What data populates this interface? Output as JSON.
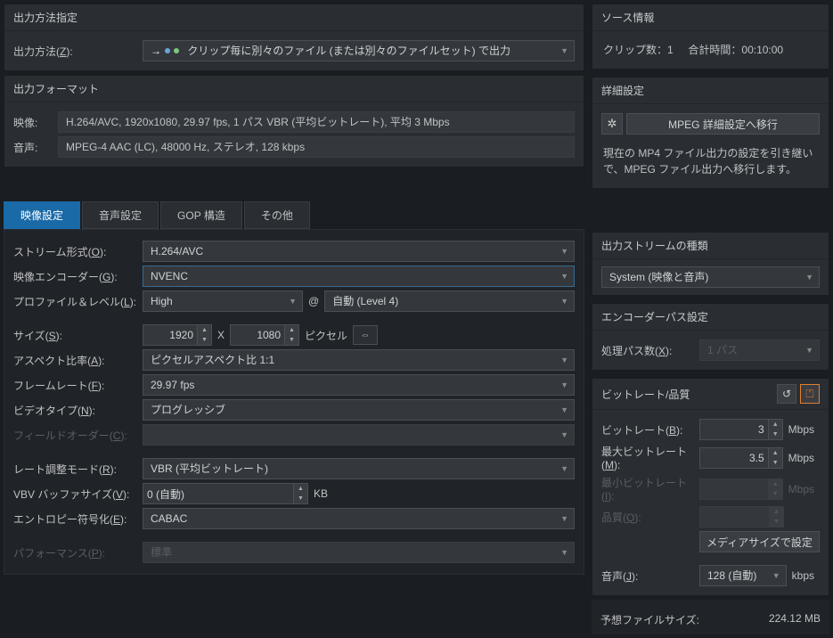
{
  "output_method": {
    "header": "出力方法指定",
    "label": "出力方法(Z):",
    "value": "クリップ毎に別々のファイル (または別々のファイルセット) で出力"
  },
  "output_format": {
    "header": "出力フォーマット",
    "video_label": "映像:",
    "video_value": "H.264/AVC, 1920x1080, 29.97 fps, 1 パス VBR (平均ビットレート), 平均 3 Mbps",
    "audio_label": "音声:",
    "audio_value": "MPEG-4 AAC (LC), 48000 Hz, ステレオ, 128 kbps"
  },
  "source_info": {
    "header": "ソース情報",
    "clips_label": "クリップ数：",
    "clips_value": "1",
    "duration_label": "合計時間：",
    "duration_value": "00:10:00"
  },
  "advanced": {
    "header": "詳細設定",
    "button": "MPEG 詳細設定へ移行",
    "desc": "現在の MP4 ファイル出力の設定を引き継いで、MPEG ファイル出力へ移行します。"
  },
  "tabs": {
    "video": "映像設定",
    "audio": "音声設定",
    "gop": "GOP 構造",
    "other": "その他"
  },
  "video_settings": {
    "stream_type_label": "ストリーム形式(O):",
    "stream_type_value": "H.264/AVC",
    "encoder_label": "映像エンコーダー(G):",
    "encoder_value": "NVENC",
    "profile_label": "プロファイル＆レベル(L):",
    "profile_value": "High",
    "at": "@",
    "level_value": "自動 (Level 4)",
    "size_label": "サイズ(S):",
    "size_w": "1920",
    "size_x": "X",
    "size_h": "1080",
    "size_unit": "ピクセル",
    "aspect_label": "アスペクト比率(A):",
    "aspect_value": "ピクセルアスペクト比 1:1",
    "framerate_label": "フレームレート(F):",
    "framerate_value": "29.97 fps",
    "video_type_label": "ビデオタイプ(N):",
    "video_type_value": "プログレッシブ",
    "field_order_label": "フィールドオーダー(C):",
    "rate_mode_label": "レート調整モード(R):",
    "rate_mode_value": "VBR (平均ビットレート)",
    "vbv_label": "VBV バッファサイズ(V):",
    "vbv_value": "0 (自動)",
    "vbv_unit": "KB",
    "entropy_label": "エントロピー符号化(E):",
    "entropy_value": "CABAC",
    "performance_label": "パフォーマンス(P):",
    "performance_value": "標準"
  },
  "stream_type_panel": {
    "header": "出力ストリームの種類",
    "value": "System (映像と音声)"
  },
  "encoder_pass": {
    "header": "エンコーダーパス設定",
    "label": "処理パス数(X):",
    "value": "1 パス"
  },
  "bitrate": {
    "header": "ビットレート/品質",
    "bitrate_label": "ビットレート(B):",
    "bitrate_value": "3",
    "bitrate_unit": "Mbps",
    "max_label": "最大ビットレート(M):",
    "max_value": "3.5",
    "max_unit": "Mbps",
    "min_label": "最小ビットレート(I):",
    "min_unit": "Mbps",
    "quality_label": "品質(Q):",
    "media_size_btn": "メディアサイズで設定",
    "audio_label": "音声(J):",
    "audio_value": "128 (自動)",
    "audio_unit": "kbps"
  },
  "estimate": {
    "label": "予想ファイルサイズ:",
    "value": "224.12 MB"
  }
}
